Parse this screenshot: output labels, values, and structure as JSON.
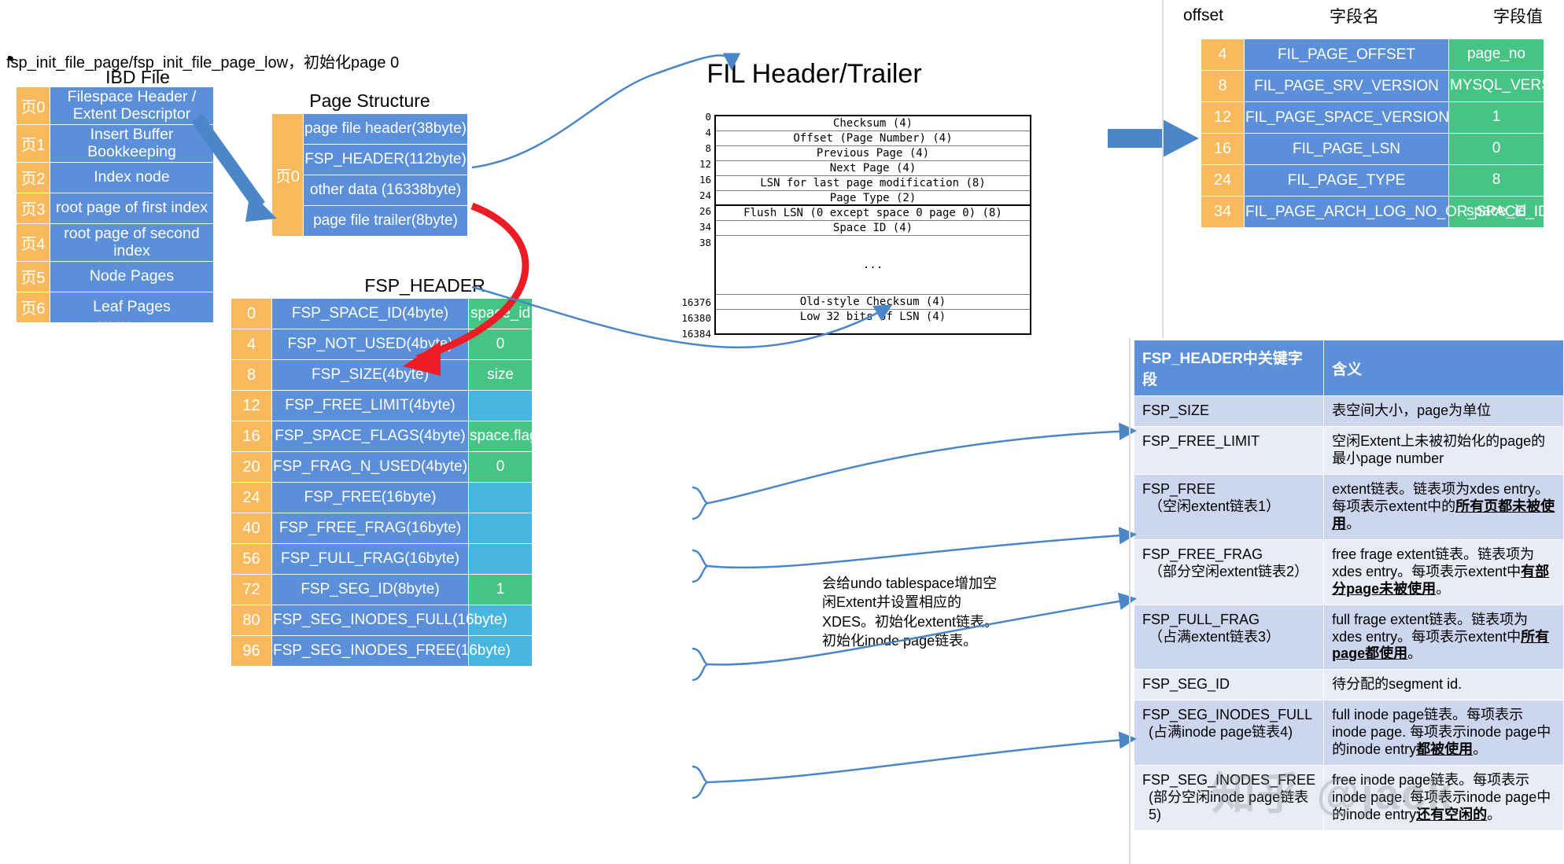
{
  "bullet": {
    "text": "fsp_init_file_page/fsp_init_file_page_low，初始化page 0"
  },
  "ibd": {
    "title": "IBD File",
    "dots": "……",
    "rows": [
      {
        "page": "页0",
        "name": "Filespace Header / Extent Descriptor"
      },
      {
        "page": "页1",
        "name": "Insert Buffer Bookkeeping"
      },
      {
        "page": "页2",
        "name": "Index node"
      },
      {
        "page": "页3",
        "name": "root page of first index"
      },
      {
        "page": "页4",
        "name": "root page of second index"
      },
      {
        "page": "页5",
        "name": "Node Pages"
      },
      {
        "page": "页6",
        "name": "Leaf Pages"
      }
    ]
  },
  "page_structure": {
    "title": "Page Structure",
    "page_label": "页0",
    "rows": [
      {
        "name": "page file header(38byte)"
      },
      {
        "name": "FSP_HEADER(112byte)"
      },
      {
        "name": "other data (16338byte)"
      },
      {
        "name": "page file trailer(8byte)"
      }
    ]
  },
  "fil": {
    "title": "FIL Header/Trailer",
    "offsets": [
      "0",
      "4",
      "8",
      "12",
      "16",
      "24",
      "26",
      "34",
      "38",
      "16376",
      "16380",
      "16384"
    ],
    "rows": [
      {
        "label": "Checksum (4)"
      },
      {
        "label": "Offset (Page Number) (4)"
      },
      {
        "label": "Previous Page (4)"
      },
      {
        "label": "Next Page (4)"
      },
      {
        "label": "LSN for last page modification (8)"
      },
      {
        "label": "Page Type (2)"
      },
      {
        "label": "Flush LSN (0 except space 0 page 0) (8)"
      },
      {
        "label": "Space ID (4)"
      },
      {
        "label": "..."
      },
      {
        "label": "Old-style Checksum (4)"
      },
      {
        "label": "Low 32 bits of LSN (4)"
      }
    ]
  },
  "fil_page_table": {
    "headers": {
      "offset": "offset",
      "field_name": "字段名",
      "field_value": "字段值"
    },
    "rows": [
      {
        "offset": "4",
        "name": "FIL_PAGE_OFFSET",
        "value": "page_no"
      },
      {
        "offset": "8",
        "name": "FIL_PAGE_SRV_VERSION",
        "value": "MYSQL_VERSION_ID"
      },
      {
        "offset": "12",
        "name": "FIL_PAGE_SPACE_VERSION",
        "value": "1"
      },
      {
        "offset": "16",
        "name": "FIL_PAGE_LSN",
        "value": "0"
      },
      {
        "offset": "24",
        "name": "FIL_PAGE_TYPE",
        "value": "8"
      },
      {
        "offset": "34",
        "name": "FIL_PAGE_ARCH_LOG_NO_OR_SPACE_ID",
        "value": "space_id"
      }
    ]
  },
  "fsp_header": {
    "title": "FSP_HEADER",
    "rows": [
      {
        "offset": "0",
        "name": "FSP_SPACE_ID(4byte)",
        "value": "space_id",
        "value_kind": "green"
      },
      {
        "offset": "4",
        "name": "FSP_NOT_USED(4byte)",
        "value": "0",
        "value_kind": "green"
      },
      {
        "offset": "8",
        "name": "FSP_SIZE(4byte)",
        "value": "size",
        "value_kind": "green"
      },
      {
        "offset": "12",
        "name": "FSP_FREE_LIMIT(4byte)",
        "value": "",
        "value_kind": "cyan"
      },
      {
        "offset": "16",
        "name": "FSP_SPACE_FLAGS(4byte)",
        "value": "space.flags",
        "value_kind": "green"
      },
      {
        "offset": "20",
        "name": "FSP_FRAG_N_USED(4byte)",
        "value": "0",
        "value_kind": "green"
      },
      {
        "offset": "24",
        "name": "FSP_FREE(16byte)",
        "value": "",
        "value_kind": "cyan"
      },
      {
        "offset": "40",
        "name": "FSP_FREE_FRAG(16byte)",
        "value": "",
        "value_kind": "cyan"
      },
      {
        "offset": "56",
        "name": "FSP_FULL_FRAG(16byte)",
        "value": "",
        "value_kind": "cyan"
      },
      {
        "offset": "72",
        "name": "FSP_SEG_ID(8byte)",
        "value": "1",
        "value_kind": "green"
      },
      {
        "offset": "80",
        "name": "FSP_SEG_INODES_FULL(16byte)",
        "value": "",
        "value_kind": "cyan"
      },
      {
        "offset": "96",
        "name": "FSP_SEG_INODES_FREE(16byte)",
        "value": "",
        "value_kind": "cyan"
      }
    ]
  },
  "fsp_desc_table": {
    "header": {
      "field": "FSP_HEADER中关键字段",
      "meaning": "含义"
    },
    "rows": [
      {
        "field": "FSP_SIZE",
        "sub": "",
        "meaning": "表空间大小，page为单位",
        "bold": "",
        "tail": ""
      },
      {
        "field": "FSP_FREE_LIMIT",
        "sub": "",
        "meaning": "空闲Extent上未被初始化的page的最小page number",
        "bold": "",
        "tail": ""
      },
      {
        "field": "FSP_FREE",
        "sub": "（空闲extent链表1）",
        "meaning": "extent链表。链表项为xdes entry。每项表示extent中的",
        "bold": "所有页都未被使用",
        "tail": "。"
      },
      {
        "field": "FSP_FREE_FRAG",
        "sub": "（部分空闲extent链表2）",
        "meaning": "free frage extent链表。链表项为xdes entry。每项表示extent中",
        "bold": "有部分page未被使用",
        "tail": "。"
      },
      {
        "field": "FSP_FULL_FRAG",
        "sub": "（占满extent链表3）",
        "meaning": "full frage extent链表。链表项为xdes entry。每项表示extent中",
        "bold": "所有page都使用",
        "tail": "。"
      },
      {
        "field": "FSP_SEG_ID",
        "sub": "",
        "meaning": "待分配的segment id.",
        "bold": "",
        "tail": ""
      },
      {
        "field": "FSP_SEG_INODES_FULL",
        "sub": "(占满inode page链表4)",
        "meaning": "full inode page链表。每项表示inode page. 每项表示inode page中的inode entry",
        "bold": "都被使用",
        "tail": "。"
      },
      {
        "field": "FSP_SEG_INODES_FREE",
        "sub": "(部分空闲inode page链表5)",
        "meaning": "free inode page链表。每项表示inode page. 每项表示inode page中的inode entry",
        "bold": "还有空闲的",
        "tail": "。"
      }
    ]
  },
  "note": {
    "text": "会给undo tablespace增加空闲Extent并设置相应的XDES。初始化extent链表。初始化inode page链表。"
  },
  "watermark": {
    "text": "知乎 @jack"
  },
  "colors": {
    "orange": "#f9b95c",
    "blue": "#5b8fd9",
    "green": "#45c483",
    "cyan": "#46b6e0",
    "arrow_blue": "#4a86c8",
    "arrow_red": "#ee1c24",
    "desc_odd": "#ccd6ee",
    "desc_even": "#e8ecf7"
  }
}
